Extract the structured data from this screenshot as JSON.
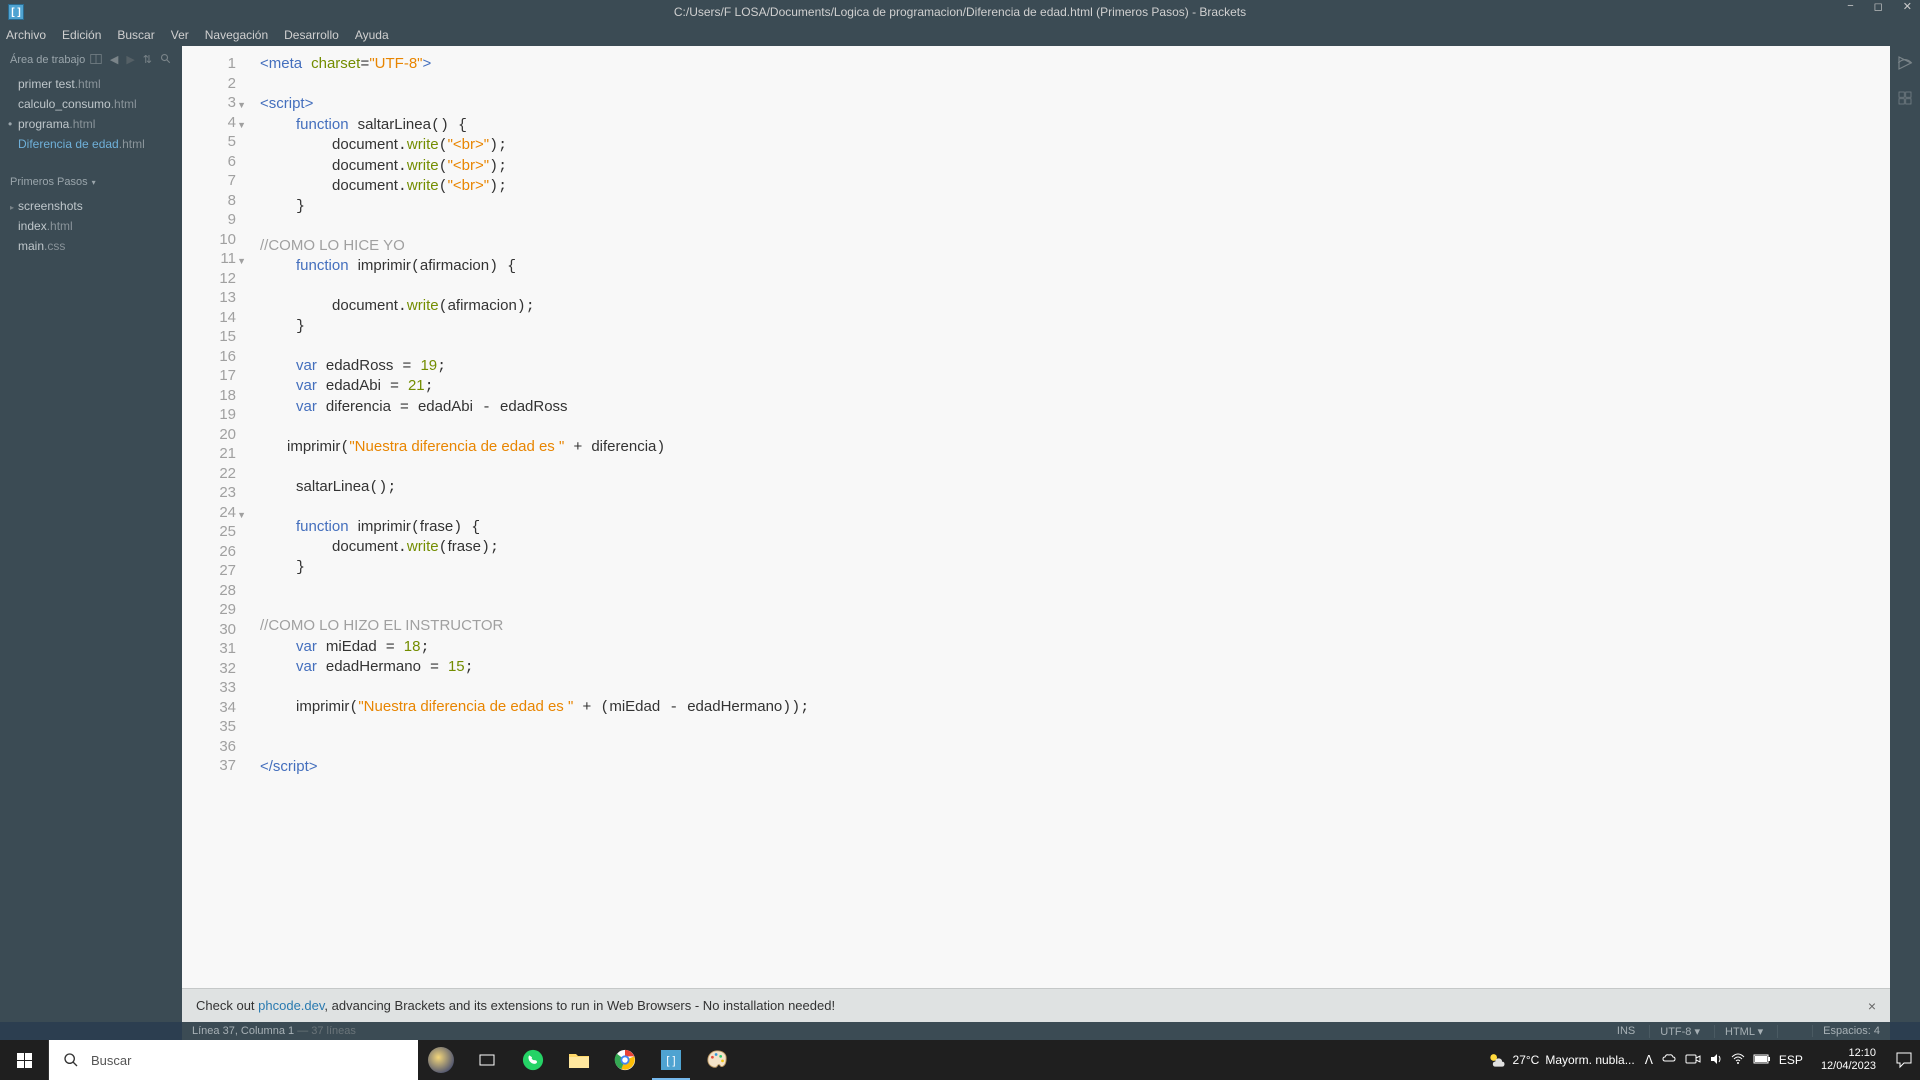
{
  "window": {
    "title": "C:/Users/F LOSA/Documents/Logica de programacion/Diferencia de edad.html (Primeros Pasos) - Brackets",
    "min": "−",
    "max": "◻",
    "close": "✕"
  },
  "menu": {
    "file": "Archivo",
    "edit": "Edición",
    "find": "Buscar",
    "view": "Ver",
    "nav": "Navegación",
    "dev": "Desarrollo",
    "help": "Ayuda"
  },
  "sidebar": {
    "working_header": "Área de trabajo",
    "working_files": [
      {
        "name": "primer test",
        "ext": ".html",
        "marked": false,
        "active": false
      },
      {
        "name": "calculo_consumo",
        "ext": ".html",
        "marked": false,
        "active": false
      },
      {
        "name": "programa",
        "ext": ".html",
        "marked": true,
        "active": false
      },
      {
        "name": "Diferencia de edad",
        "ext": ".html",
        "marked": false,
        "active": true
      }
    ],
    "project_name": "Primeros Pasos",
    "folders": [
      "screenshots"
    ],
    "files": [
      {
        "name": "index",
        "ext": ".html"
      },
      {
        "name": "main",
        "ext": ".css"
      }
    ]
  },
  "gutter_folds": {
    "3": "▼",
    "4": "▼",
    "11": "▼",
    "24": "▼"
  },
  "notice": {
    "pre": "Check out ",
    "link": "phcode.dev",
    "post": ", advancing Brackets and its extensions to run in Web Browsers - No installation needed!",
    "close": "×"
  },
  "status": {
    "left_a": "Línea 37, Columna 1",
    "left_b": " — 37 líneas",
    "ins": "INS",
    "enc": "UTF-8 ▾",
    "lang": "HTML ▾",
    "spaces": "Espacios: 4"
  },
  "taskbar": {
    "search_placeholder": "Buscar",
    "weather_temp": "27°C",
    "weather_txt": "Mayorm. nubla...",
    "lang": "ESP",
    "time": "12:10",
    "date": "12/04/2023"
  }
}
